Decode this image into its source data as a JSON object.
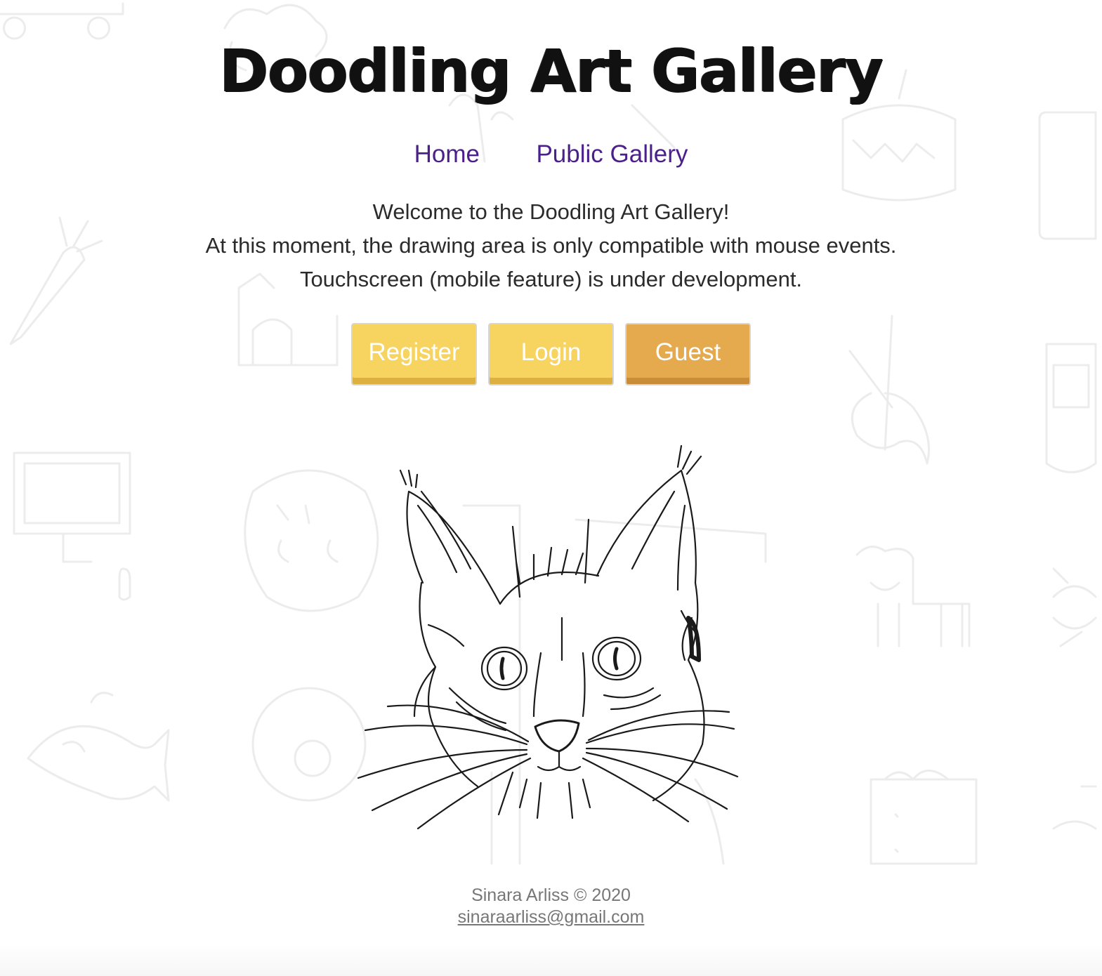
{
  "header": {
    "title": "Doodling Art Gallery"
  },
  "nav": {
    "items": [
      {
        "label": "Home"
      },
      {
        "label": "Public Gallery"
      }
    ],
    "link_color": "#4b1f8c"
  },
  "intro": {
    "lines": [
      "Welcome to the Doodling Art Gallery!",
      "At this moment, the drawing area is only compatible with mouse events.",
      "Touchscreen (mobile feature) is under development."
    ]
  },
  "actions": {
    "register_label": "Register",
    "login_label": "Login",
    "guest_label": "Guest",
    "colors": {
      "primary": "#f7d35f",
      "guest": "#e5a94e"
    }
  },
  "hero": {
    "image": "cat-sketch-icon"
  },
  "footer": {
    "copyright": "Sinara Arliss © 2020",
    "email": "sinaraarliss@gmail.com"
  }
}
